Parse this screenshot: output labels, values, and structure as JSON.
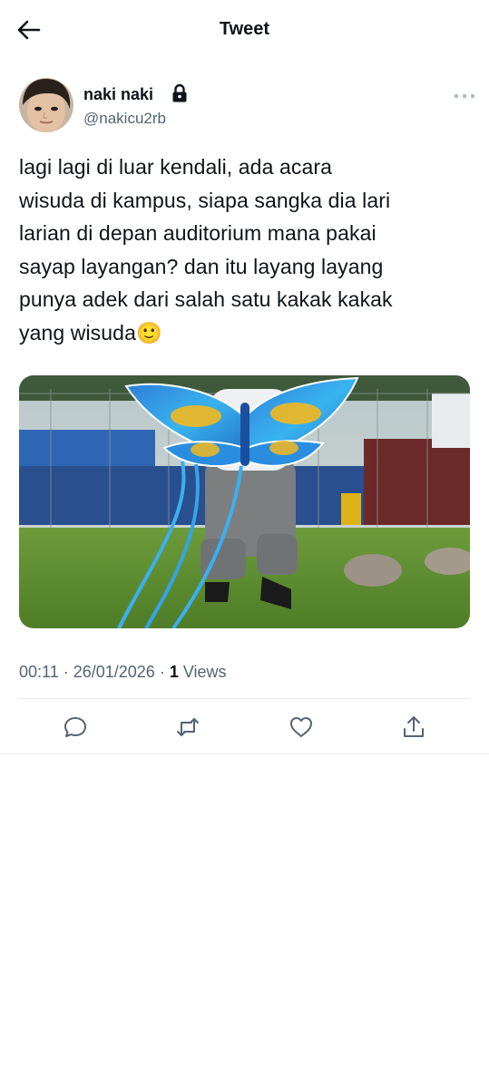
{
  "header": {
    "title": "Tweet",
    "back_icon": "arrow-left-icon"
  },
  "author": {
    "display_name": "naki naki",
    "handle": "@nakicu2rb",
    "protected_icon": "lock-icon",
    "more_icon": "more-horizontal-icon"
  },
  "tweet": {
    "text": "lagi lagi di luar kendali, ada acara\nwisuda di kampus, siapa sangka dia lari\nlarian di depan auditorium mana pakai\nsayap layangan? dan itu layang layang\npunya adek dari salah satu kakak kakak\nyang wisuda🙂",
    "time": "00:11",
    "separator": " · ",
    "date": "26/01/2026",
    "views_count": "1",
    "views_label": " Views"
  },
  "actions": [
    {
      "icon": "reply-icon"
    },
    {
      "icon": "retweet-icon"
    },
    {
      "icon": "like-icon"
    },
    {
      "icon": "share-icon"
    }
  ],
  "colors": {
    "text": "#0f1419",
    "muted": "#536471",
    "divider": "#e6e9ec",
    "kite_blue": "#3aa0e8",
    "kite_yellow": "#f2b81e",
    "grass": "#5d8a2f"
  }
}
